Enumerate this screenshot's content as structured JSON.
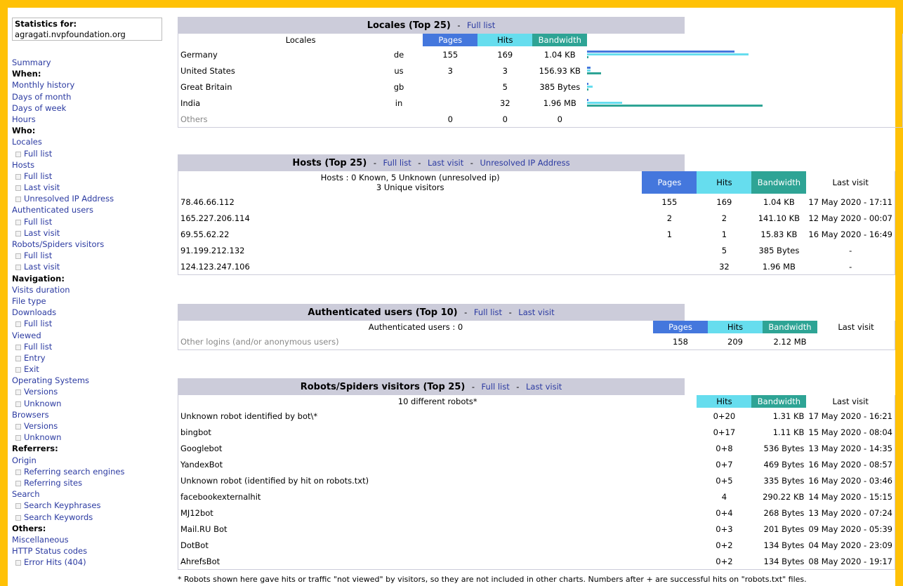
{
  "sidebar": {
    "stats_label": "Statistics for:",
    "site": "agragati.nvpfoundation.org",
    "items": [
      {
        "t": "Summary",
        "k": "link"
      },
      {
        "t": "When:",
        "k": "head"
      },
      {
        "t": "Monthly history",
        "k": "link"
      },
      {
        "t": "Days of month",
        "k": "link"
      },
      {
        "t": "Days of week",
        "k": "link"
      },
      {
        "t": "Hours",
        "k": "link"
      },
      {
        "t": "Who:",
        "k": "head"
      },
      {
        "t": "Locales",
        "k": "link"
      },
      {
        "t": "Full list",
        "k": "sub"
      },
      {
        "t": "Hosts",
        "k": "link"
      },
      {
        "t": "Full list",
        "k": "sub"
      },
      {
        "t": "Last visit",
        "k": "sub"
      },
      {
        "t": "Unresolved IP Address",
        "k": "sub"
      },
      {
        "t": "Authenticated users",
        "k": "link"
      },
      {
        "t": "Full list",
        "k": "sub"
      },
      {
        "t": "Last visit",
        "k": "sub"
      },
      {
        "t": "Robots/Spiders visitors",
        "k": "link"
      },
      {
        "t": "Full list",
        "k": "sub"
      },
      {
        "t": "Last visit",
        "k": "sub"
      },
      {
        "t": "Navigation:",
        "k": "head"
      },
      {
        "t": "Visits duration",
        "k": "link"
      },
      {
        "t": "File type",
        "k": "link"
      },
      {
        "t": "Downloads",
        "k": "link"
      },
      {
        "t": "Full list",
        "k": "sub"
      },
      {
        "t": "Viewed",
        "k": "link"
      },
      {
        "t": "Full list",
        "k": "sub"
      },
      {
        "t": "Entry",
        "k": "sub"
      },
      {
        "t": "Exit",
        "k": "sub"
      },
      {
        "t": "Operating Systems",
        "k": "link"
      },
      {
        "t": "Versions",
        "k": "sub"
      },
      {
        "t": "Unknown",
        "k": "sub"
      },
      {
        "t": "Browsers",
        "k": "link"
      },
      {
        "t": "Versions",
        "k": "sub"
      },
      {
        "t": "Unknown",
        "k": "sub"
      },
      {
        "t": "Referrers:",
        "k": "head"
      },
      {
        "t": "Origin",
        "k": "link"
      },
      {
        "t": "Referring search engines",
        "k": "sub"
      },
      {
        "t": "Referring sites",
        "k": "sub"
      },
      {
        "t": "Search",
        "k": "link"
      },
      {
        "t": "Search Keyphrases",
        "k": "sub"
      },
      {
        "t": "Search Keywords",
        "k": "sub"
      },
      {
        "t": "Others:",
        "k": "head"
      },
      {
        "t": "Miscellaneous",
        "k": "link"
      },
      {
        "t": "HTTP Status codes",
        "k": "link"
      },
      {
        "t": "Error Hits (404)",
        "k": "sub"
      }
    ]
  },
  "common": {
    "full_list": "Full list",
    "last_visit": "Last visit",
    "unresolved": "Unresolved IP Address",
    "sep": "-",
    "pages": "Pages",
    "hits": "Hits",
    "bandwidth": "Bandwidth"
  },
  "locales": {
    "title": "Locales (Top 25)",
    "col_locales": "Locales",
    "rows": [
      {
        "name": "Germany",
        "code": "de",
        "pages": "155",
        "hits": "169",
        "bw": "1.04 KB",
        "bar_pages": 0.84,
        "bar_hits": 0.92,
        "bar_bw": 0.0
      },
      {
        "name": "United States",
        "code": "us",
        "pages": "3",
        "hits": "3",
        "bw": "156.93 KB",
        "bar_pages": 0.02,
        "bar_hits": 0.02,
        "bar_bw": 0.08
      },
      {
        "name": "Great Britain",
        "code": "gb",
        "pages": "",
        "hits": "5",
        "bw": "385 Bytes",
        "bar_pages": 0.0,
        "bar_hits": 0.03,
        "bar_bw": 0.0
      },
      {
        "name": "India",
        "code": "in",
        "pages": "",
        "hits": "32",
        "bw": "1.96 MB",
        "bar_pages": 0.0,
        "bar_hits": 0.2,
        "bar_bw": 1.0
      }
    ],
    "others": {
      "name": "Others",
      "pages": "0",
      "hits": "0",
      "bw": "0"
    }
  },
  "hosts": {
    "title": "Hosts (Top 25)",
    "summary1": "Hosts : 0 Known, 5 Unknown (unresolved ip)",
    "summary2": "3 Unique visitors",
    "rows": [
      {
        "host": "78.46.66.112",
        "pages": "155",
        "hits": "169",
        "bw": "1.04 KB",
        "last": "17 May 2020 - 17:11"
      },
      {
        "host": "165.227.206.114",
        "pages": "2",
        "hits": "2",
        "bw": "141.10 KB",
        "last": "12 May 2020 - 00:07"
      },
      {
        "host": "69.55.62.22",
        "pages": "1",
        "hits": "1",
        "bw": "15.83 KB",
        "last": "16 May 2020 - 16:49"
      },
      {
        "host": "91.199.212.132",
        "pages": "",
        "hits": "5",
        "bw": "385 Bytes",
        "last": "-"
      },
      {
        "host": "124.123.247.106",
        "pages": "",
        "hits": "32",
        "bw": "1.96 MB",
        "last": "-"
      }
    ]
  },
  "auth": {
    "title": "Authenticated users (Top 10)",
    "summary": "Authenticated users : 0",
    "other": "Other logins (and/or anonymous users)",
    "pages": "158",
    "hits": "209",
    "bw": "2.12 MB",
    "last": ""
  },
  "robots": {
    "title": "Robots/Spiders visitors (Top 25)",
    "summary": "10 different robots*",
    "rows": [
      {
        "name": "Unknown robot identified by bot\\*",
        "hits": "0+20",
        "bw": "1.31 KB",
        "last": "17 May 2020 - 16:21"
      },
      {
        "name": "bingbot",
        "hits": "0+17",
        "bw": "1.11 KB",
        "last": "15 May 2020 - 08:04"
      },
      {
        "name": "Googlebot",
        "hits": "0+8",
        "bw": "536 Bytes",
        "last": "13 May 2020 - 14:35"
      },
      {
        "name": "YandexBot",
        "hits": "0+7",
        "bw": "469 Bytes",
        "last": "16 May 2020 - 08:57"
      },
      {
        "name": "Unknown robot (identified by hit on robots.txt)",
        "hits": "0+5",
        "bw": "335 Bytes",
        "last": "16 May 2020 - 03:46"
      },
      {
        "name": "facebookexternalhit",
        "hits": "4",
        "bw": "290.22 KB",
        "last": "14 May 2020 - 15:15"
      },
      {
        "name": "MJ12bot",
        "hits": "0+4",
        "bw": "268 Bytes",
        "last": "13 May 2020 - 07:24"
      },
      {
        "name": "Mail.RU Bot",
        "hits": "0+3",
        "bw": "201 Bytes",
        "last": "09 May 2020 - 05:39"
      },
      {
        "name": "DotBot",
        "hits": "0+2",
        "bw": "134 Bytes",
        "last": "04 May 2020 - 23:09"
      },
      {
        "name": "AhrefsBot",
        "hits": "0+2",
        "bw": "134 Bytes",
        "last": "08 May 2020 - 19:17"
      }
    ],
    "footnote": "* Robots shown here gave hits or traffic \"not viewed\" by visitors, so they are not included in other charts. Numbers after + are successful hits on \"robots.txt\" files."
  },
  "colors": {
    "frame": "#ffc106",
    "title_bg": "#ccccda",
    "pages": "#4477dd",
    "hits": "#66ddee",
    "bandwidth": "#2ea495",
    "link": "#2b3aa1"
  }
}
